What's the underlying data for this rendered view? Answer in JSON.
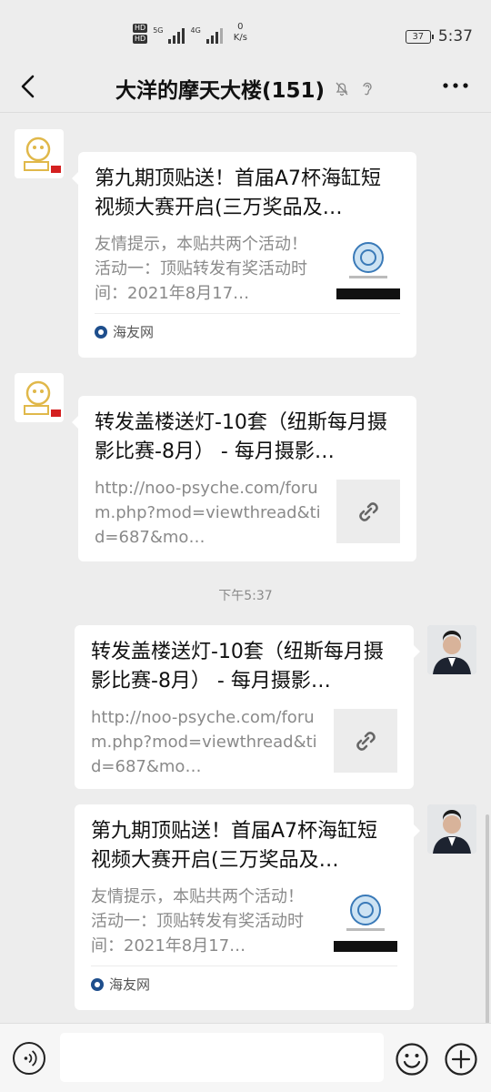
{
  "status_bar": {
    "hd1": "HD",
    "hd2": "HD",
    "gen1": "5G",
    "gen2": "4G",
    "speed_value": "0",
    "speed_unit": "K/s",
    "battery": "37",
    "time": "5:37"
  },
  "header": {
    "title": "大洋的摩天大楼(151)"
  },
  "messages": [
    {
      "title": "第九期顶贴送！首届A7杯海缸短视频大赛开启(三万奖品及…",
      "desc": "友情提示，本贴共两个活动！活动一：顶贴转发有奖活动时间：2021年8月17…",
      "source": "海友网"
    },
    {
      "title": "转发盖楼送灯-10套（纽斯每月摄影比赛-8月） - 每月摄影…",
      "desc": "http://noo-psyche.com/forum.php?mod=viewthread&tid=687&mo…"
    },
    {
      "title": "转发盖楼送灯-10套（纽斯每月摄影比赛-8月） - 每月摄影…",
      "desc": "http://noo-psyche.com/forum.php?mod=viewthread&tid=687&mo…"
    },
    {
      "title": "第九期顶贴送！首届A7杯海缸短视频大赛开启(三万奖品及…",
      "desc": "友情提示，本贴共两个活动！活动一：顶贴转发有奖活动时间：2021年8月17…",
      "source": "海友网"
    }
  ],
  "timestamp": "下午5:37",
  "icons": {
    "back": "back-arrow-icon",
    "mute": "mute-bell-icon",
    "ear": "earpiece-icon",
    "more": "more-dots-icon",
    "link": "link-icon",
    "voice": "voice-icon",
    "emoji": "emoji-icon",
    "plus": "plus-icon"
  },
  "colors": {
    "background": "#ededed",
    "card": "#ffffff",
    "secondary_text": "#8a8a8a"
  }
}
